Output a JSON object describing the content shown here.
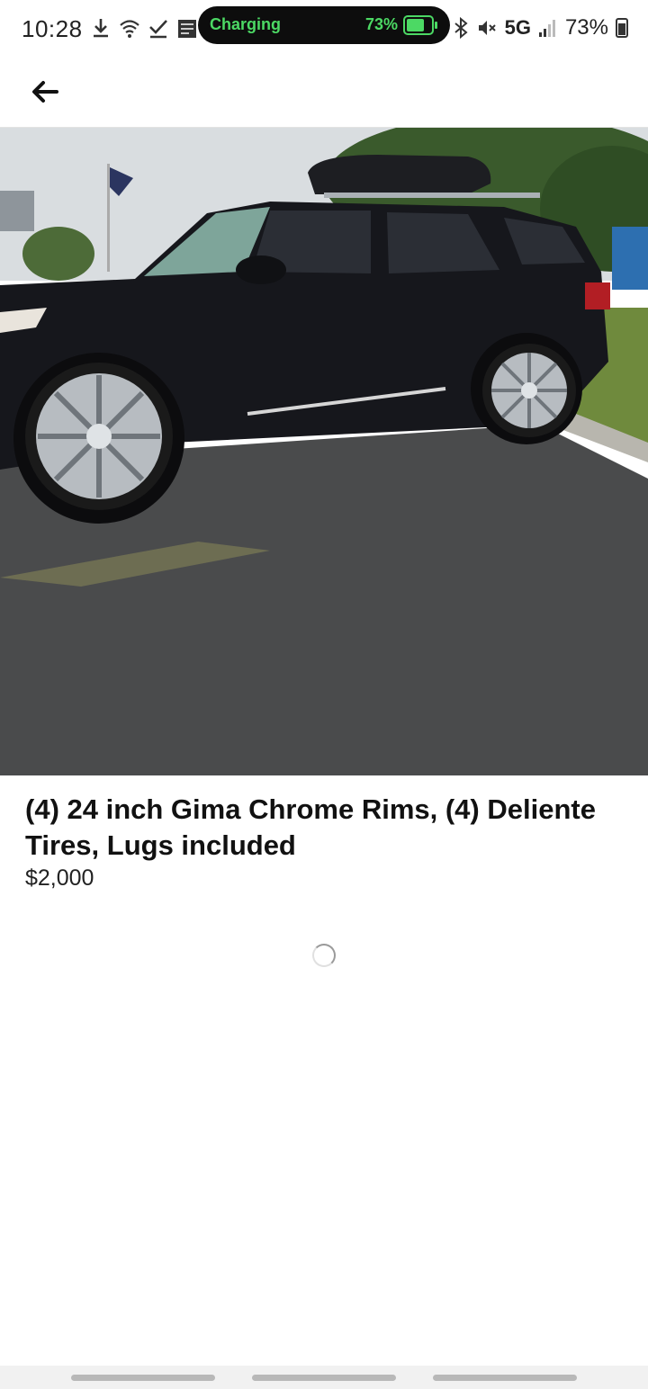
{
  "status_bar": {
    "time": "10:28",
    "charging_label": "Charging",
    "charging_percent": "73%",
    "charging_level": 0.73,
    "network": "5G",
    "battery_percent": "73%"
  },
  "header": {
    "back_icon": "arrow-left-icon"
  },
  "listing": {
    "photo_subject": "black-suv-chrome-rims",
    "title": "(4) 24 inch Gima Chrome Rims, (4) Deliente Tires, Lugs included",
    "price": "$2,000"
  },
  "colors": {
    "charging_green": "#4cd964",
    "text": "#111111",
    "divider": "#e3e3e3"
  }
}
